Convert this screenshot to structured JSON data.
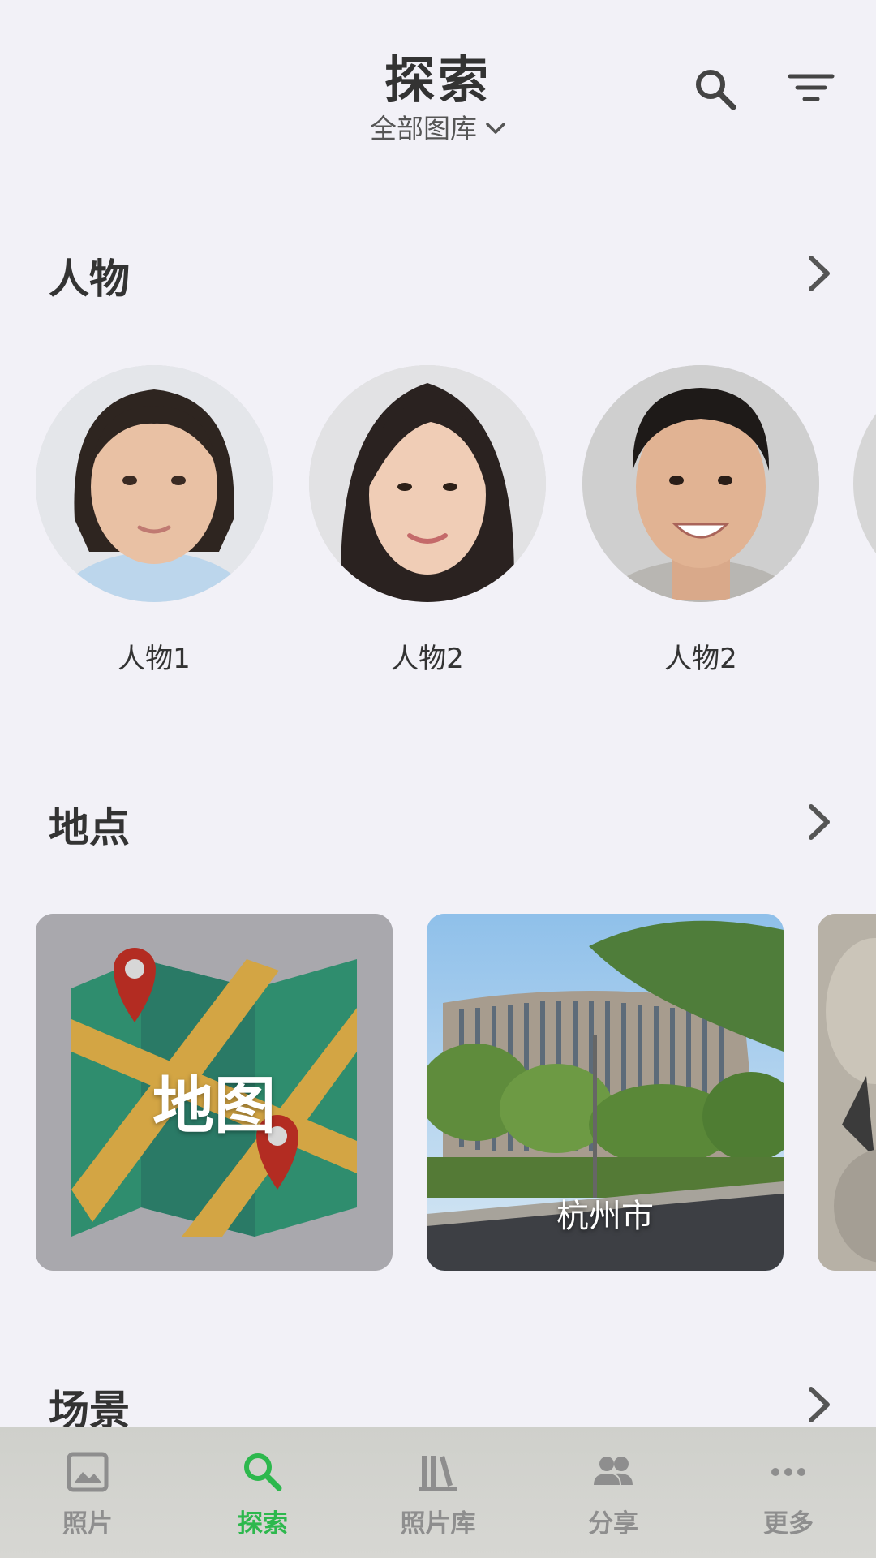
{
  "header": {
    "title": "探索",
    "library_selector": "全部图库"
  },
  "sections": {
    "people": {
      "title": "人物"
    },
    "places": {
      "title": "地点"
    },
    "scenes": {
      "title": "场景"
    }
  },
  "people": [
    {
      "name": "人物1"
    },
    {
      "name": "人物2"
    },
    {
      "name": "人物2"
    }
  ],
  "places": {
    "map_label": "地图",
    "photo_label": "杭州市"
  },
  "bottom_nav": {
    "items": [
      {
        "label": "照片",
        "icon": "photo-icon",
        "active": false
      },
      {
        "label": "探索",
        "icon": "search-icon",
        "active": true
      },
      {
        "label": "照片库",
        "icon": "library-icon",
        "active": false
      },
      {
        "label": "分享",
        "icon": "people-icon",
        "active": false
      },
      {
        "label": "更多",
        "icon": "more-icon",
        "active": false
      }
    ]
  },
  "colors": {
    "accent": "#2db84d",
    "background": "#f2f1f7",
    "text": "#333333",
    "inactive": "#8e8e8e"
  }
}
